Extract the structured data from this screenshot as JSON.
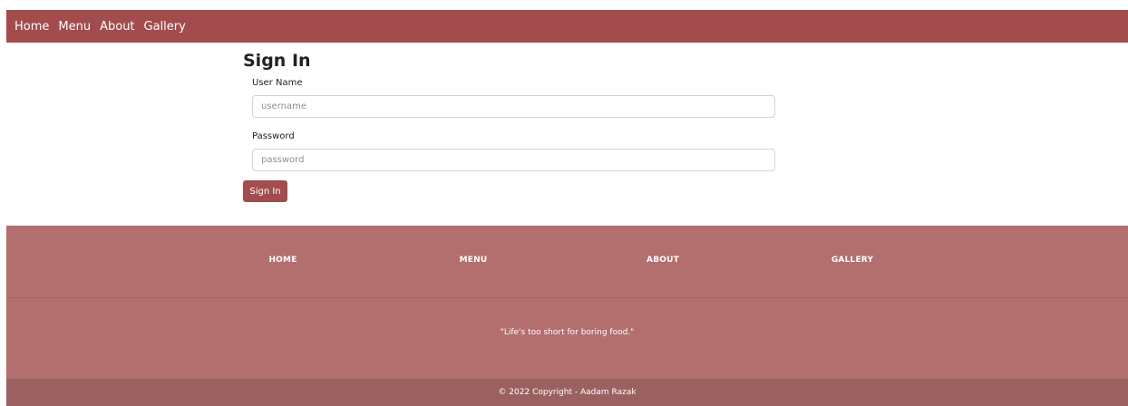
{
  "navbar": {
    "links": [
      "Home",
      "Menu",
      "About",
      "Gallery"
    ]
  },
  "signin": {
    "title": "Sign In",
    "username_label": "User Name",
    "username_placeholder": "username",
    "password_label": "Password",
    "password_placeholder": "password",
    "submit_label": "Sign In"
  },
  "footer": {
    "links": [
      "HOME",
      "MENU",
      "ABOUT",
      "GALLERY"
    ],
    "quote": "\"Life's too short for boring food.\"",
    "copyright": "© 2022 Copyright - Aadam Razak"
  },
  "colors": {
    "primary": "#a24c4d",
    "footer_bg": "#b36e6e",
    "copyright_bg": "#9b6060"
  }
}
